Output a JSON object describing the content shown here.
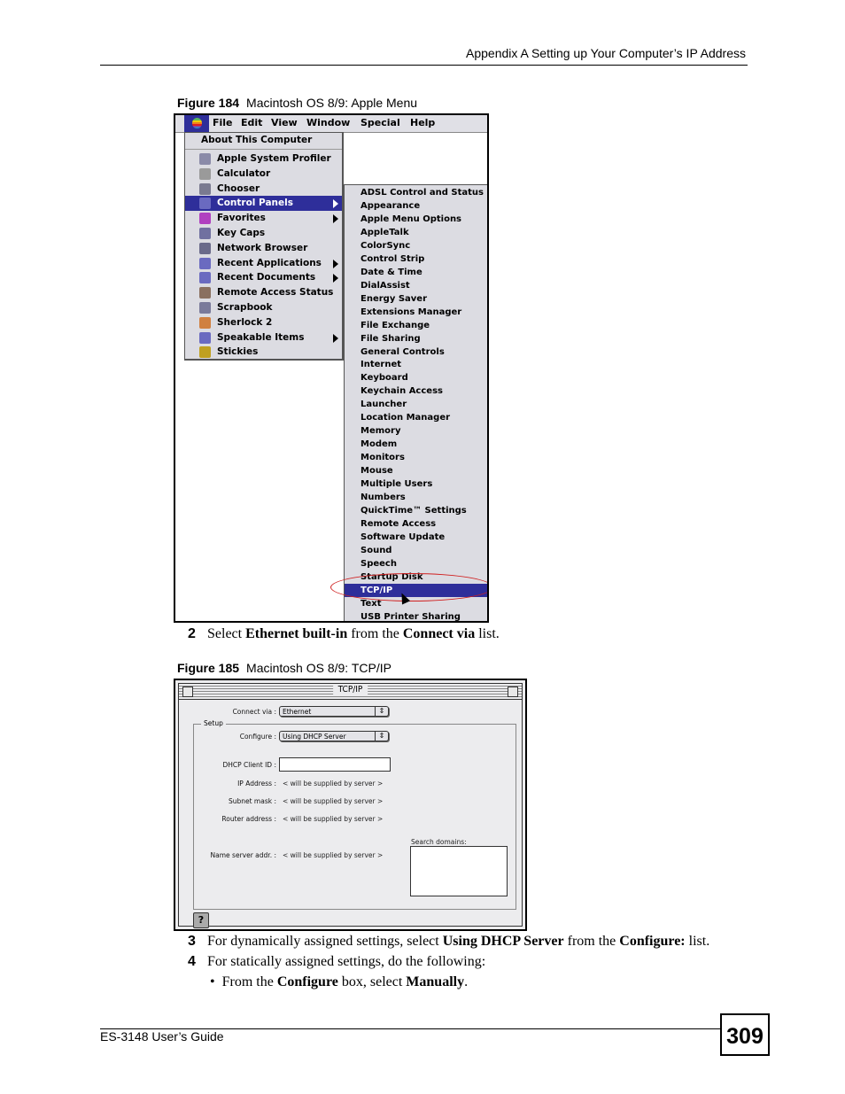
{
  "header": {
    "title": "Appendix A Setting up Your Computer’s IP Address"
  },
  "figure184": {
    "number": "Figure 184",
    "caption": "Macintosh OS 8/9: Apple Menu",
    "menubar": [
      "File",
      "Edit",
      "View",
      "Window",
      "Special",
      "Help"
    ],
    "apple_menu": {
      "about": "About This Computer",
      "items": [
        {
          "label": "Apple System Profiler",
          "icon": "profiler-icon",
          "submenu": false
        },
        {
          "label": "Calculator",
          "icon": "calculator-icon",
          "submenu": false
        },
        {
          "label": "Chooser",
          "icon": "chooser-icon",
          "submenu": false
        },
        {
          "label": "Control Panels",
          "icon": "control-panels-icon",
          "submenu": true,
          "selected": true
        },
        {
          "label": "Favorites",
          "icon": "favorites-icon",
          "submenu": true
        },
        {
          "label": "Key Caps",
          "icon": "keycaps-icon",
          "submenu": false
        },
        {
          "label": "Network Browser",
          "icon": "network-icon",
          "submenu": false
        },
        {
          "label": "Recent Applications",
          "icon": "recent-apps-icon",
          "submenu": true
        },
        {
          "label": "Recent Documents",
          "icon": "recent-docs-icon",
          "submenu": true
        },
        {
          "label": "Remote Access Status",
          "icon": "remote-access-icon",
          "submenu": false
        },
        {
          "label": "Scrapbook",
          "icon": "scrapbook-icon",
          "submenu": false
        },
        {
          "label": "Sherlock 2",
          "icon": "sherlock-icon",
          "submenu": false
        },
        {
          "label": "Speakable Items",
          "icon": "speakable-icon",
          "submenu": true
        },
        {
          "label": "Stickies",
          "icon": "stickies-icon",
          "submenu": false
        }
      ]
    },
    "control_panels": [
      "ADSL Control and Status",
      "Appearance",
      "Apple Menu Options",
      "AppleTalk",
      "ColorSync",
      "Control Strip",
      "Date & Time",
      "DialAssist",
      "Energy Saver",
      "Extensions Manager",
      "File Exchange",
      "File Sharing",
      "General Controls",
      "Internet",
      "Keyboard",
      "Keychain Access",
      "Launcher",
      "Location Manager",
      "Memory",
      "Modem",
      "Monitors",
      "Mouse",
      "Multiple Users",
      "Numbers",
      "QuickTime™ Settings",
      "Remote Access",
      "Software Update",
      "Sound",
      "Speech",
      "Startup Disk",
      "TCP/IP",
      "Text",
      "USB Printer Sharing"
    ],
    "selected_panel": "TCP/IP",
    "highlight_color": "#2e2e9a",
    "annotation_color": "#d02020"
  },
  "step2": {
    "num": "2",
    "t1": "Select ",
    "b1": "Ethernet built-in",
    "t2": " from the ",
    "b2": "Connect via",
    "t3": " list."
  },
  "figure185": {
    "number": "Figure 185",
    "caption": "Macintosh OS 8/9: TCP/IP",
    "window_title": "TCP/IP",
    "connect_via_label": "Connect via :",
    "connect_via_value": "Ethernet",
    "setup_label": "Setup",
    "configure_label": "Configure :",
    "configure_value": "Using DHCP Server",
    "dhcp_client_id_label": "DHCP Client ID :",
    "dhcp_client_id_value": "",
    "ip_label": "IP Address :",
    "subnet_label": "Subnet mask :",
    "router_label": "Router address :",
    "nameserver_label": "Name server addr. :",
    "supplied_text": "< will be supplied by server >",
    "search_domains_label": "Search domains:",
    "help_glyph": "?"
  },
  "step3": {
    "num": "3",
    "t1": "For dynamically assigned settings, select ",
    "b1": "Using DHCP Server",
    "t2": " from the ",
    "b2": "Configure:",
    "t3": " list."
  },
  "step4": {
    "num": "4",
    "t1": "For statically assigned settings, do the following:"
  },
  "bullet1": {
    "glyph": "•",
    "t1": "From the ",
    "b1": "Configure",
    "t2": " box, select ",
    "b2": "Manually",
    "t3": "."
  },
  "footer": {
    "guide": "ES-3148 User’s Guide",
    "page": "309"
  }
}
